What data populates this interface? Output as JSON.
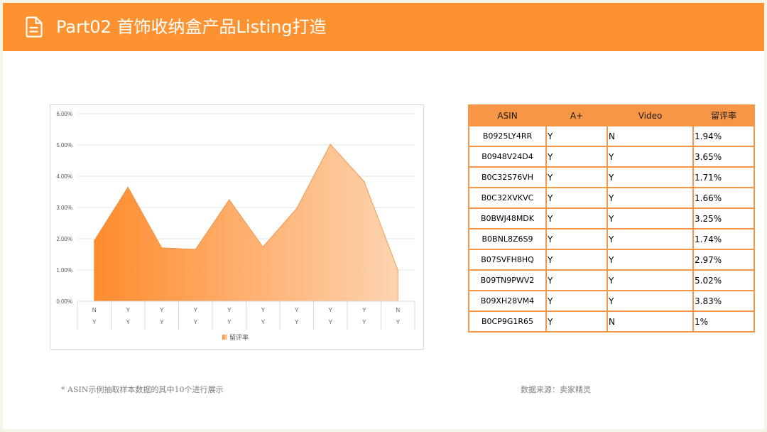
{
  "header": {
    "title": "Part02 首饰收纳盒产品Listing打造",
    "icon": "document-icon",
    "background": "#fe9230"
  },
  "chart_data": {
    "type": "area",
    "categories": [
      "N / Y",
      "Y / Y",
      "Y / Y",
      "Y / Y",
      "Y / Y",
      "Y / Y",
      "Y / Y",
      "Y / Y",
      "Y / Y",
      "N / Y"
    ],
    "x_labels_row1": [
      "N",
      "Y",
      "Y",
      "Y",
      "Y",
      "Y",
      "Y",
      "Y",
      "Y",
      "N"
    ],
    "x_labels_row2": [
      "Y",
      "Y",
      "Y",
      "Y",
      "Y",
      "Y",
      "Y",
      "Y",
      "Y",
      "Y"
    ],
    "series": [
      {
        "name": "留评率",
        "values": [
          0.0194,
          0.0365,
          0.0171,
          0.0166,
          0.0325,
          0.0174,
          0.0297,
          0.0502,
          0.0383,
          0.01
        ]
      }
    ],
    "y_ticks": [
      "0.00%",
      "1.00%",
      "2.00%",
      "3.00%",
      "4.00%",
      "5.00%",
      "6.00%"
    ],
    "ylim": [
      0,
      0.06
    ],
    "grid": true,
    "legend": "bottom",
    "colors": {
      "start": "#fe8c2e",
      "end": "#fdd3b0",
      "stroke": "#f28a35"
    }
  },
  "table": {
    "headers": [
      "ASIN",
      "A+",
      "Video",
      "留评率"
    ],
    "rows": [
      [
        "B0925LY4RR",
        "Y",
        "N",
        "1.94%"
      ],
      [
        "B0948V24D4",
        "Y",
        "Y",
        "3.65%"
      ],
      [
        "B0C32S76VH",
        "Y",
        "Y",
        "1.71%"
      ],
      [
        "B0C32XVKVC",
        "Y",
        "Y",
        "1.66%"
      ],
      [
        "B0BWJ48MDK",
        "Y",
        "Y",
        "3.25%"
      ],
      [
        "B0BNL8Z6S9",
        "Y",
        "Y",
        "1.74%"
      ],
      [
        "B07SVFH8HQ",
        "Y",
        "Y",
        "2.97%"
      ],
      [
        "B09TN9PWV2",
        "Y",
        "Y",
        "5.02%"
      ],
      [
        "B09XH28VM4",
        "Y",
        "Y",
        "3.83%"
      ],
      [
        "B0CP9G1R65",
        "Y",
        "N",
        "1%"
      ]
    ]
  },
  "footnote": "* ASIN示例抽取样本数据的其中10个进行展示",
  "source": "数据来源：卖家精灵"
}
